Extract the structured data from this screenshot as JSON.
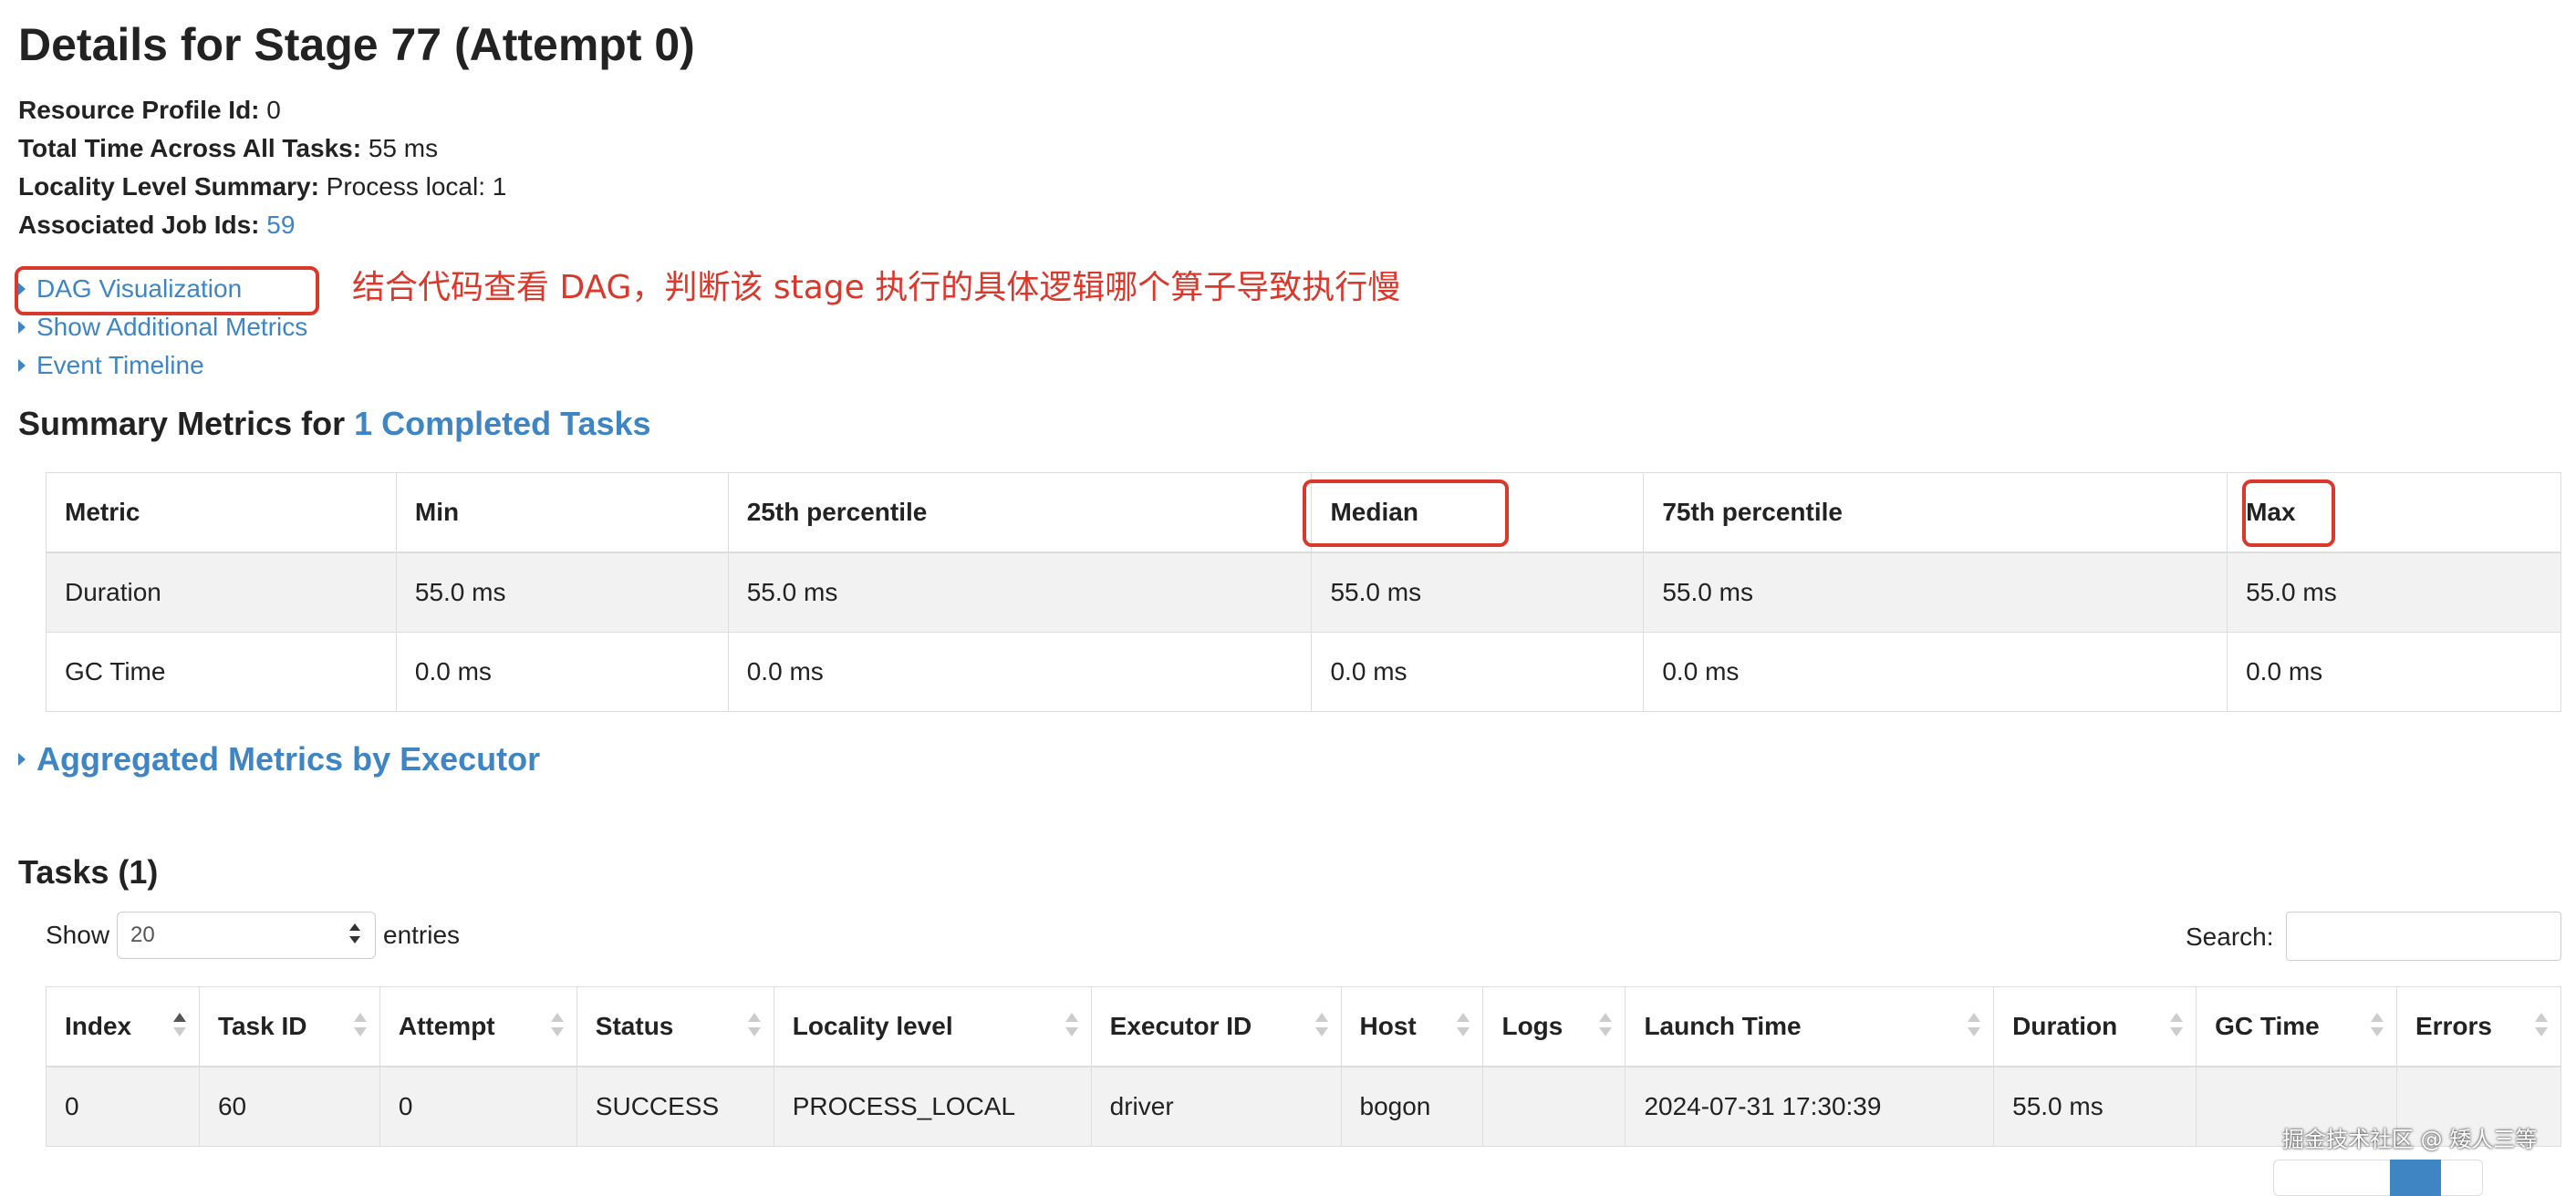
{
  "page_title": "Details for Stage 77 (Attempt 0)",
  "info": {
    "resource_profile_label": "Resource Profile Id:",
    "resource_profile_value": " 0",
    "total_time_label": "Total Time Across All Tasks:",
    "total_time_value": " 55 ms",
    "locality_label": "Locality Level Summary:",
    "locality_value": " Process local: 1",
    "job_ids_label": "Associated Job Ids:",
    "job_ids_value": "59"
  },
  "expanders": {
    "dag": "DAG Visualization",
    "additional_metrics": "Show Additional Metrics",
    "event_timeline": "Event Timeline",
    "aggregated": "Aggregated Metrics by Executor"
  },
  "annotation": {
    "text": "结合代码查看 DAG，判断该 stage 执行的具体逻辑哪个算子导致执行慢",
    "color": "#d9382b"
  },
  "summary": {
    "heading_prefix": "Summary Metrics for ",
    "heading_link": "1 Completed Tasks",
    "columns": [
      "Metric",
      "Min",
      "25th percentile",
      "Median",
      "75th percentile",
      "Max"
    ],
    "rows": [
      [
        "Duration",
        "55.0 ms",
        "55.0 ms",
        "55.0 ms",
        "55.0 ms",
        "55.0 ms"
      ],
      [
        "GC Time",
        "0.0 ms",
        "0.0 ms",
        "0.0 ms",
        "0.0 ms",
        "0.0 ms"
      ]
    ]
  },
  "tasks": {
    "heading": "Tasks (1)",
    "show_label": "Show",
    "page_size": "20",
    "entries_label": "entries",
    "search_label": "Search:",
    "search_value": "",
    "columns": [
      "Index",
      "Task ID",
      "Attempt",
      "Status",
      "Locality level",
      "Executor ID",
      "Host",
      "Logs",
      "Launch Time",
      "Duration",
      "GC Time",
      "Errors"
    ],
    "rows": [
      [
        "0",
        "60",
        "0",
        "SUCCESS",
        "PROCESS_LOCAL",
        "driver",
        "bogon",
        "",
        "2024-07-31 17:30:39",
        "55.0 ms",
        "",
        ""
      ]
    ]
  },
  "watermark": "掘金技术社区 @ 矮人三等",
  "colors": {
    "link": "#3f85c3",
    "annotation": "#d9382b",
    "row_stripe": "#f2f2f2",
    "border": "#dddddd"
  }
}
